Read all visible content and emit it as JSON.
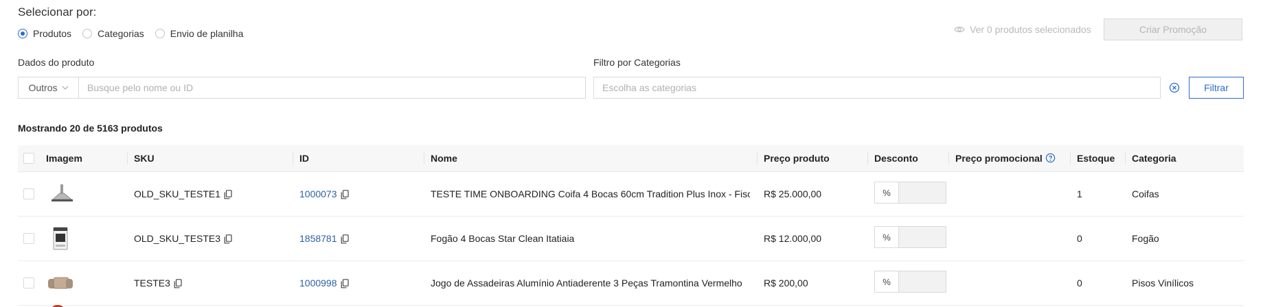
{
  "header": {
    "title": "Selecionar por:",
    "radios": [
      {
        "label": "Produtos",
        "selected": true
      },
      {
        "label": "Categorias",
        "selected": false
      },
      {
        "label": "Envio de planilha",
        "selected": false
      }
    ],
    "view_selected": "Ver 0 produtos selecionados",
    "create_button": "Criar Promoção"
  },
  "filters": {
    "product_label": "Dados do produto",
    "product_type": "Outros",
    "product_placeholder": "Busque pelo nome ou ID",
    "category_label": "Filtro por Categorias",
    "category_placeholder": "Escolha as categorias",
    "filter_button": "Filtrar"
  },
  "table": {
    "count_text": "Mostrando 20 de 5163 produtos",
    "columns": {
      "image": "Imagem",
      "sku": "SKU",
      "id": "ID",
      "name": "Nome",
      "price": "Preço produto",
      "discount": "Desconto",
      "promo_price": "Preço promocional",
      "stock": "Estoque",
      "category": "Categoria"
    },
    "rows": [
      {
        "image": "range-hood",
        "sku": "OLD_SKU_TESTE1",
        "id": "1000073",
        "name": "TESTE TIME ONBOARDING Coifa 4 Bocas 60cm Tradition Plus Inox - Fisc...",
        "price": "R$ 25.000,00",
        "discount_symbol": "%",
        "stock": "1",
        "category": "Coifas"
      },
      {
        "image": "stove",
        "sku": "OLD_SKU_TESTE3",
        "id": "1858781",
        "name": "Fogão 4 Bocas Star Clean Itatiaia",
        "price": "R$ 12.000,00",
        "discount_symbol": "%",
        "stock": "0",
        "category": "Fogão"
      },
      {
        "image": "baking-pans",
        "sku": "TESTE3",
        "id": "1000998",
        "name": "Jogo de Assadeiras Alumínio Antiaderente 3 Peças Tramontina Vermelho",
        "price": "R$ 200,00",
        "discount_symbol": "%",
        "stock": "0",
        "category": "Pisos Vinílicos"
      }
    ]
  },
  "colors": {
    "accent": "#2d6cc8",
    "link": "#2d5fa8"
  }
}
